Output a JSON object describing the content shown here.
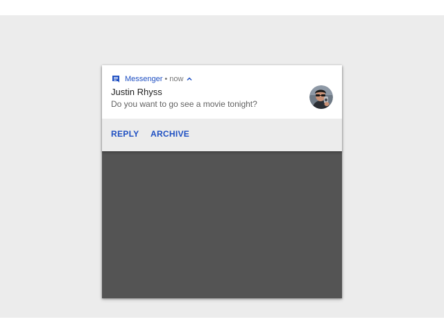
{
  "notification": {
    "app_name": "Messenger",
    "separator": "•",
    "time": "now",
    "sender": "Justin Rhyss",
    "message": "Do you want to go see a movie tonight?",
    "icons": {
      "app": "message-app-icon",
      "expand": "chevron-up-icon",
      "avatar": "contact-avatar"
    },
    "actions": [
      {
        "label": "REPLY"
      },
      {
        "label": "ARCHIVE"
      }
    ]
  },
  "colors": {
    "accent": "#1e4fc2",
    "background": "#ececec",
    "screen": "#545454",
    "card": "#ffffff"
  }
}
